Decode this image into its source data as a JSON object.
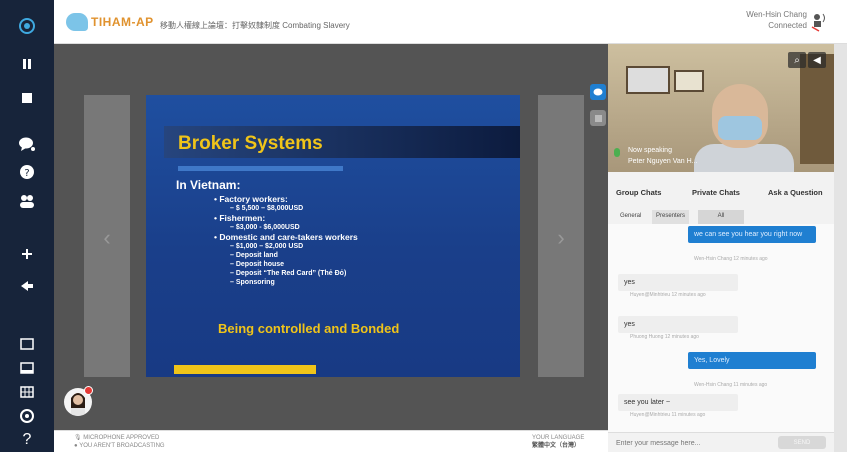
{
  "header": {
    "logo_text": "TIHAM-AP",
    "room_title": "移動人權線上論壇：打擊奴隸制度 Combating Slavery",
    "user_name": "Wen-Hsin Chang",
    "user_status": "Connected"
  },
  "slide": {
    "title": "Broker Systems",
    "heading": "In Vietnam:",
    "items": [
      {
        "level": 1,
        "text": "Factory workers:"
      },
      {
        "level": 2,
        "text": "$ 5,500 – $8,000USD"
      },
      {
        "level": 1,
        "text": "Fishermen:"
      },
      {
        "level": 2,
        "text": "$3,000 - $6,000USD"
      },
      {
        "level": 1,
        "text": "Domestic and care-takers workers"
      },
      {
        "level": 2,
        "text": "$1,000 – $2,000 USD"
      },
      {
        "level": 2,
        "text": "Deposit land"
      },
      {
        "level": 2,
        "text": "Deposit house"
      },
      {
        "level": 2,
        "text": "Deposit “The Red Card” (Thẻ Đỏ)"
      },
      {
        "level": 2,
        "text": "Sponsoring"
      }
    ],
    "footer": "Being controlled and Bonded"
  },
  "video": {
    "speaking_label": "Now speaking",
    "speaker_name": "Peter Nguyen Van H..."
  },
  "chat": {
    "tabs": [
      "Group Chats",
      "Private Chats",
      "Ask a Question"
    ],
    "sub_tabs": [
      "General",
      "Presenters",
      "All"
    ],
    "messages": [
      {
        "dir": "out",
        "text": "we can see you hear you right now",
        "meta": "Wen-Hsin Chang 12 minutes ago"
      },
      {
        "dir": "in",
        "text": "yes",
        "meta": "Huyen@Minhtrieu 12 minutes ago"
      },
      {
        "dir": "in",
        "text": "yes",
        "meta": "Phuong Huong 12 minutes ago"
      },
      {
        "dir": "out",
        "text": "Yes, Lovely",
        "meta": "Wen-Hsin Chang 11 minutes ago"
      },
      {
        "dir": "in",
        "text": "see you later ~",
        "meta": "Huyen@Minhtrieu 11 minutes ago"
      }
    ],
    "input_placeholder": "Enter your message here...",
    "send_label": "SEND"
  },
  "status": {
    "mic_line": "MICROPHONE APPROVED",
    "broadcast_line": "YOU AREN'T BROADCASTING",
    "language_label": "YOUR LANGUAGE",
    "language_value": "繁體中文（台灣）"
  },
  "icons": {
    "sidebar": [
      "logo-icon",
      "pause-icon",
      "stop-icon",
      "chat-bubble-icon",
      "question-icon",
      "people-icon",
      "plus-icon",
      "share-icon",
      "layout-fullscreen-icon",
      "layout-split-icon",
      "layout-grid-icon",
      "settings-icon",
      "help-icon"
    ],
    "accent": "#1f7fd1",
    "sidebar_bg": "#17243a",
    "slide_accent": "#f0c419"
  }
}
